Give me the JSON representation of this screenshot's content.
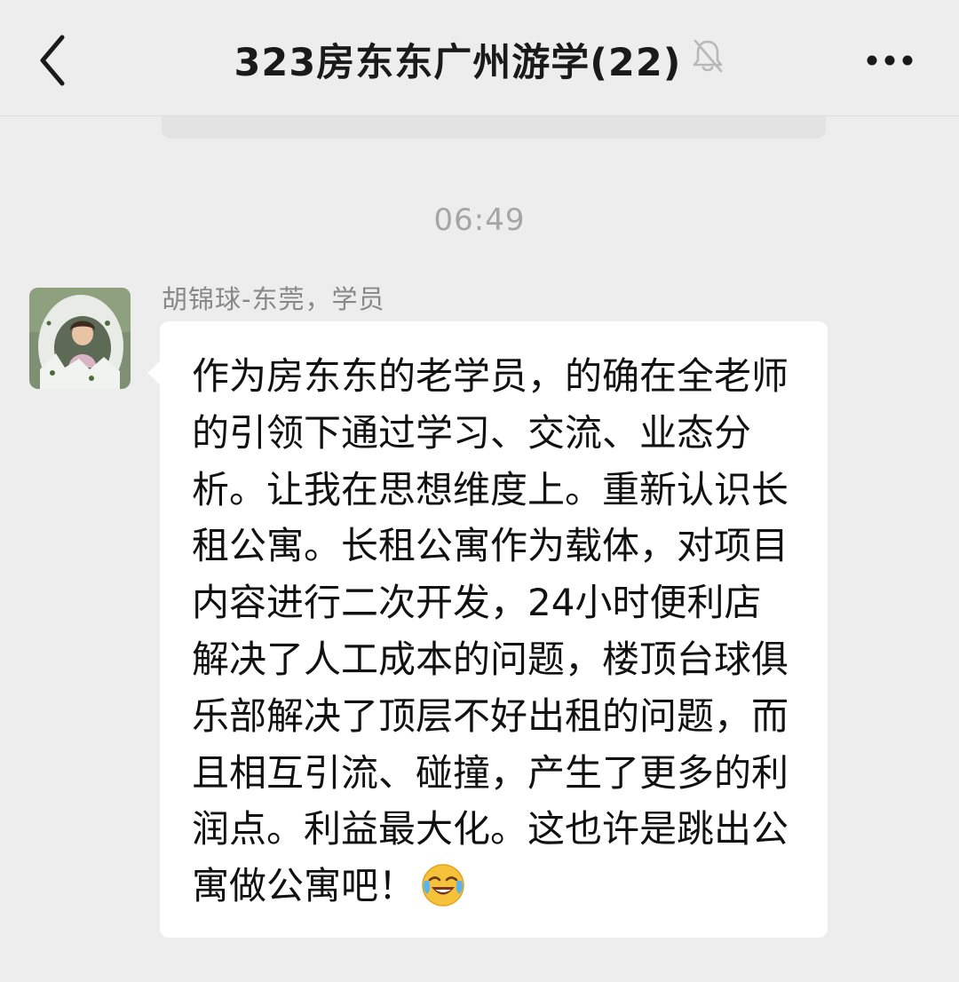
{
  "header": {
    "back_icon": "chevron-left-icon",
    "title": "323房东东广州游学(22)",
    "mute_icon": "bell-muted-icon",
    "more_icon": "more-dots-icon"
  },
  "timestamp": "06:49",
  "message": {
    "sender": "胡锦球-东莞，学员",
    "text": "作为房东东的老学员，的确在全老师的引领下通过学习、交流、业态分析。让我在思想维度上。重新认识长租公寓。长租公寓作为载体，对项目内容进行二次开发，24小时便利店解决了人工成本的问题，楼顶台球俱乐部解决了顶层不好出租的问题，而且相互引流、碰撞，产生了更多的利润点。利益最大化。这也许是跳出公寓做公寓吧！",
    "emoji": "laughing-with-tears-emoji",
    "avatar": "avatar-photo-child-in-egg"
  },
  "colors": {
    "background": "#ededed",
    "bubble": "#ffffff",
    "timestamp": "#a5a5a5",
    "sender": "#888888"
  }
}
